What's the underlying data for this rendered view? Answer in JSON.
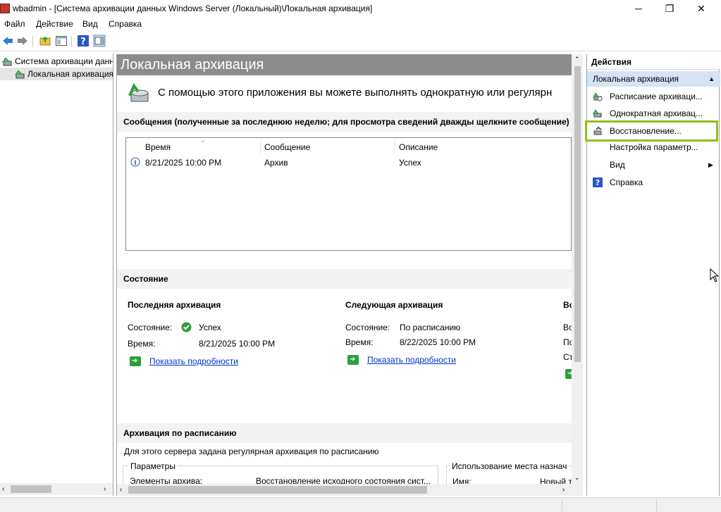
{
  "window": {
    "title": "wbadmin - [Система архивации данных Windows Server (Локальный)\\Локальная архивация]",
    "minimize_glyph": "─",
    "restore_glyph": "❐",
    "close_glyph": "✕"
  },
  "menu": [
    "Файл",
    "Действие",
    "Вид",
    "Справка"
  ],
  "tree": {
    "root": "Система архивации данн",
    "child": "Локальная архивация"
  },
  "center": {
    "header": "Локальная архивация",
    "intro": "С помощью этого приложения вы можете выполнять однократную или регулярн",
    "messages": {
      "section_title": "Сообщения (полученные за последнюю неделю; для просмотра сведений дважды щелкните сообщение)",
      "columns": [
        "Время",
        "Сообщение",
        "Описание"
      ],
      "rows": [
        {
          "icon": "info-icon",
          "time": "8/21/2025 10:00 PM",
          "message": "Архив",
          "description": "Успех"
        }
      ]
    },
    "status": {
      "section_title": "Состояние",
      "last": {
        "title": "Последняя архивация",
        "state_label": "Состояние:",
        "state_value": "Успех",
        "time_label": "Время:",
        "time_value": "8/21/2025 10:00 PM",
        "details_link": "Показать подробности"
      },
      "next": {
        "title": "Следующая архивация",
        "state_label": "Состояние:",
        "state_value": "По расписанию",
        "time_label": "Время:",
        "time_value": "8/22/2025 10:00 PM",
        "details_link": "Показать подробности"
      },
      "third": {
        "title": "Во",
        "line1": "Вс",
        "line2": "По",
        "line3": "Ст"
      }
    },
    "schedule": {
      "section_title": "Архивация по расписанию",
      "description": "Для этого сервера задана регулярная архивация по расписанию",
      "params_group": "Параметры",
      "items_label": "Элементы архива:",
      "items_value": "Восстановление исходного состояния сист...",
      "usage_group": "Использование места назнач",
      "name_label": "Имя:",
      "name_value": "Новый т"
    }
  },
  "actions": {
    "title": "Действия",
    "group": "Локальная архивация",
    "items": [
      {
        "label": "Расписание архиваци...",
        "icon": "schedule-backup-icon"
      },
      {
        "label": "Однократная архивац...",
        "icon": "once-backup-icon"
      },
      {
        "label": "Восстановление...",
        "icon": "recover-icon"
      },
      {
        "label": "Настройка параметр...",
        "icon": ""
      },
      {
        "label": "Вид",
        "icon": ""
      },
      {
        "label": "Справка",
        "icon": "help-icon"
      }
    ]
  },
  "colors": {
    "header_bg": "#8c8c8c",
    "highlight": "#8fbf1f",
    "link": "#0033cc",
    "actions_group_bg": "#d5e3f3"
  }
}
